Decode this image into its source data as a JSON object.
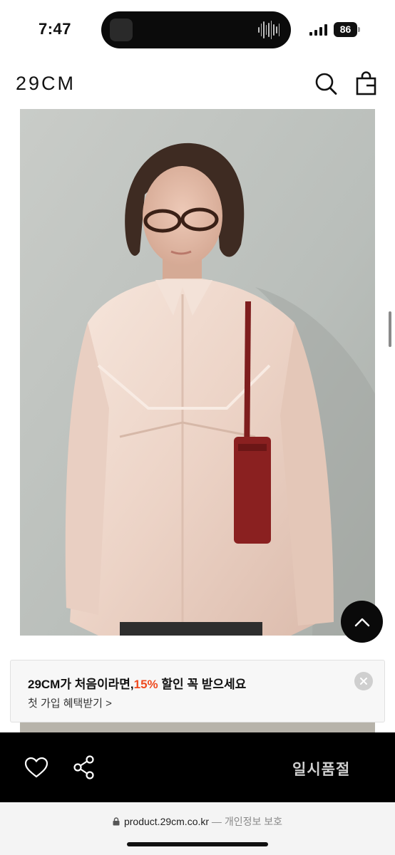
{
  "status_bar": {
    "time": "7:47",
    "battery": "86"
  },
  "header": {
    "logo": "29CM",
    "icons": [
      "search-icon",
      "shopping-bag-icon"
    ]
  },
  "product_image": {
    "description_icon": "product-photo"
  },
  "top_button": {
    "icon": "chevron-up-icon"
  },
  "promo": {
    "text_before": "29CM가 처음이라면,",
    "accent": "15%",
    "text_after": " 할인 꼭 받으세요",
    "cta": "첫 가입 혜택받기 >",
    "accent_color": "#ef4a1f"
  },
  "action_bar": {
    "status_label": "일시품절",
    "icons": [
      "heart-icon",
      "share-icon"
    ]
  },
  "url_bar": {
    "domain": "product.29cm.co.kr",
    "separator": " — ",
    "privacy": "개인정보 보호"
  }
}
